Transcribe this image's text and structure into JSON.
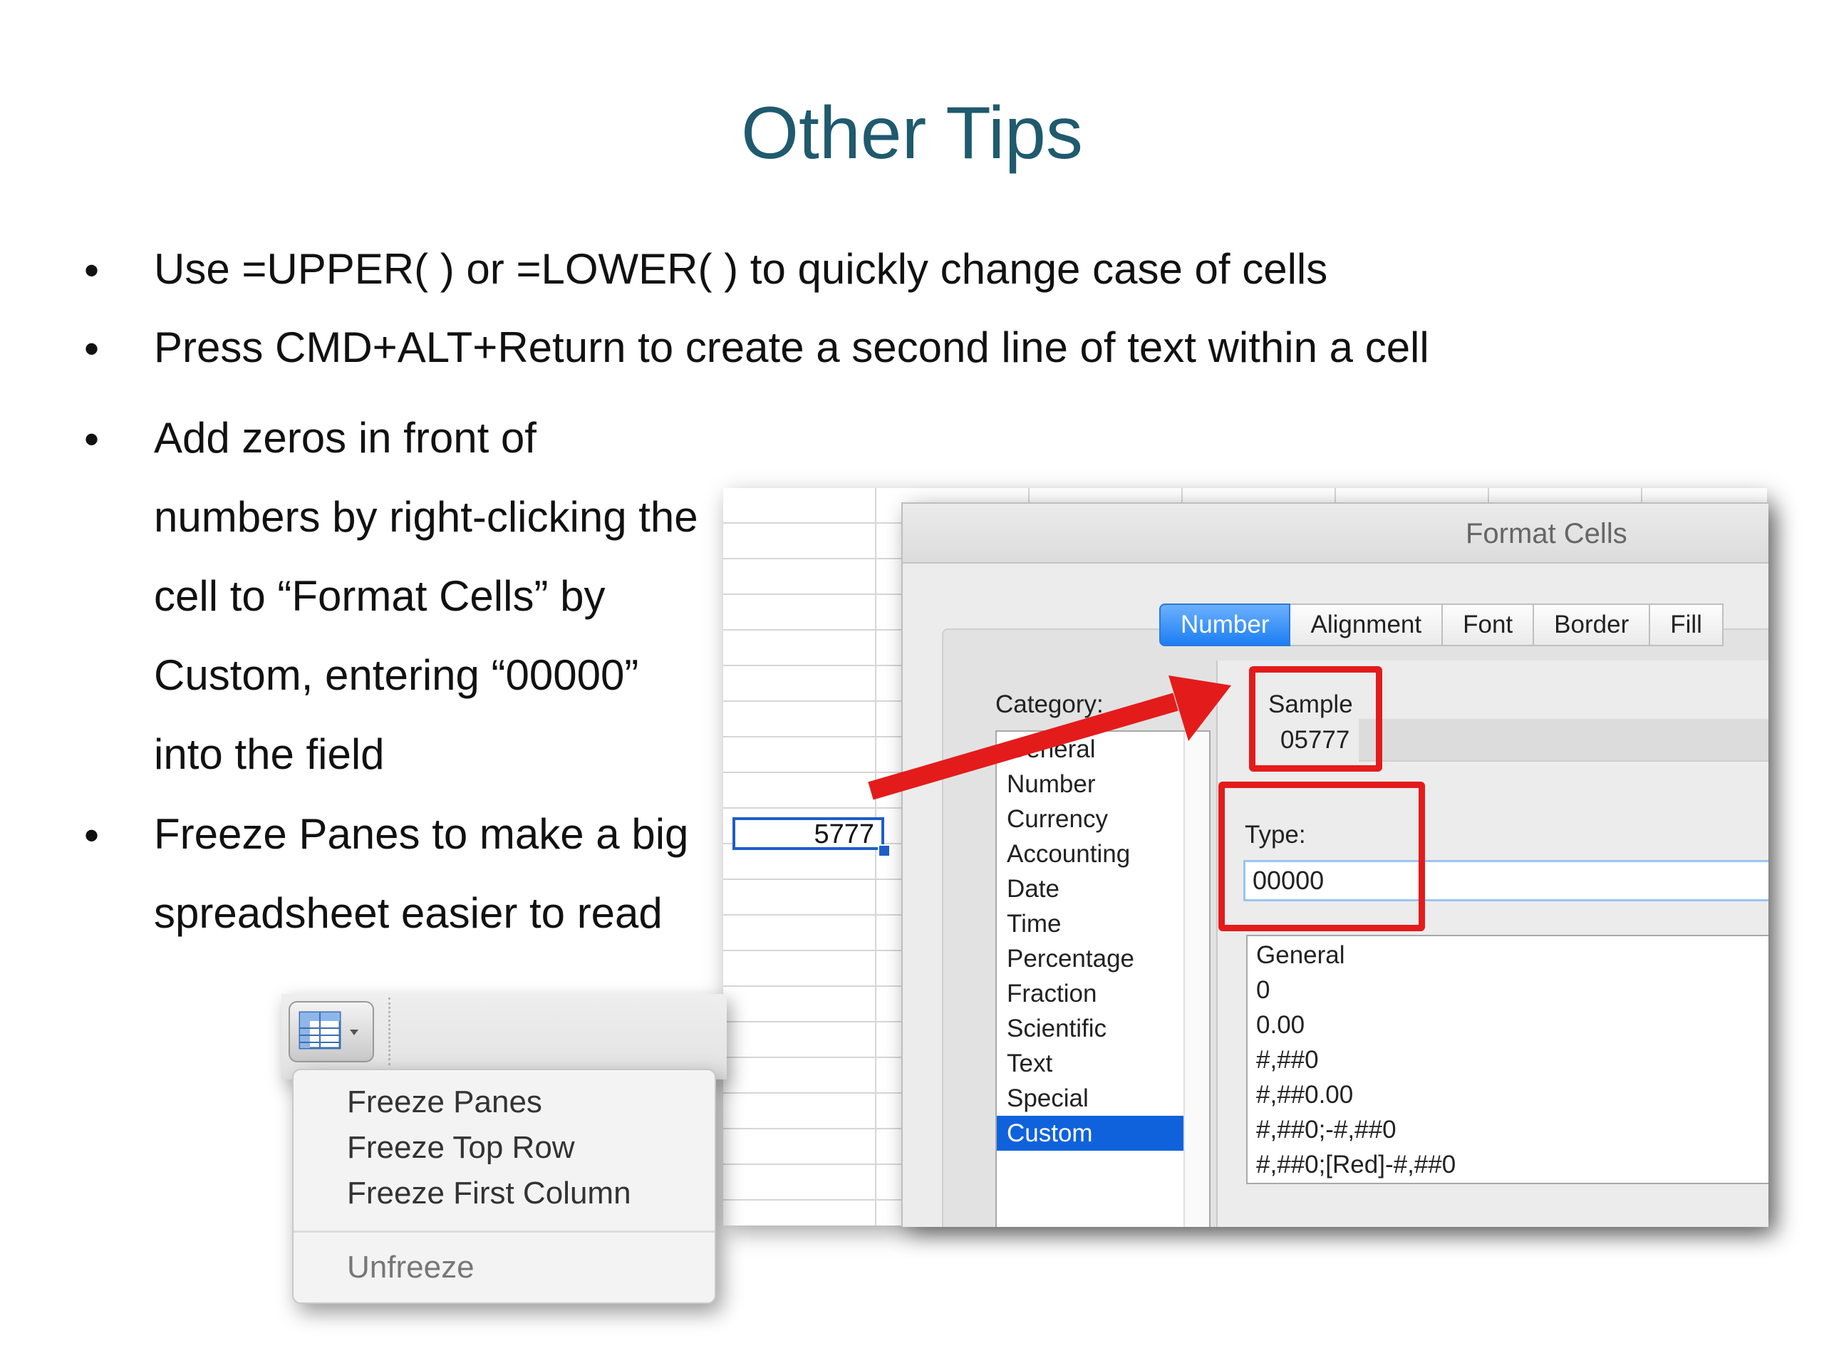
{
  "slide": {
    "title": "Other Tips",
    "bullets": [
      {
        "lines": [
          "Use =UPPER( ) or =LOWER( ) to quickly change case of cells"
        ]
      },
      {
        "lines": [
          "Press CMD+ALT+Return to create a second line of text within a cell"
        ]
      },
      {
        "lines": [
          "Add zeros in front of",
          "numbers by right-clicking the",
          "cell to “Format Cells” by",
          "Custom, entering “00000”",
          "into the field"
        ]
      },
      {
        "lines": [
          "Freeze Panes to make a big",
          "spreadsheet easier to read"
        ]
      }
    ],
    "bullet_symbol": "•"
  },
  "spreadsheet": {
    "selected_cell_value": "5777"
  },
  "format_cells_dialog": {
    "title": "Format Cells",
    "tabs": [
      {
        "label": "Number",
        "active": true
      },
      {
        "label": "Alignment",
        "active": false
      },
      {
        "label": "Font",
        "active": false
      },
      {
        "label": "Border",
        "active": false
      },
      {
        "label": "Fill",
        "active": false
      }
    ],
    "category_label": "Category:",
    "categories": [
      "General",
      "Number",
      "Currency",
      "Accounting",
      "Date",
      "Time",
      "Percentage",
      "Fraction",
      "Scientific",
      "Text",
      "Special",
      "Custom"
    ],
    "selected_category": "Custom",
    "sample_label": "Sample",
    "sample_value": "05777",
    "type_label": "Type:",
    "type_value": "00000",
    "format_types": [
      "General",
      "0",
      "0.00",
      "#,##0",
      "#,##0.00",
      "#,##0;-#,##0",
      "#,##0;[Red]-#,##0"
    ]
  },
  "freeze_menu": {
    "items": [
      "Freeze Panes",
      "Freeze Top Row",
      "Freeze First Column"
    ],
    "disabled_item": "Unfreeze"
  },
  "colors": {
    "title": "#1f5a6e",
    "highlight_red": "#e41b1b",
    "active_tab_blue": "#1c7ef2",
    "selection_blue": "#0f62dc"
  }
}
